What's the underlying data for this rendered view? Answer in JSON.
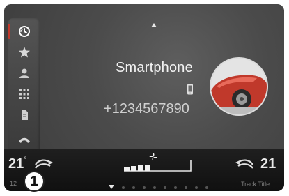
{
  "contact": {
    "name": "Smartphone",
    "number": "+1234567890"
  },
  "climate": {
    "left_temp": "21",
    "left_unit": "°",
    "right_temp": "21",
    "left_sub": "12",
    "right_sub": "Track Title"
  },
  "callout": {
    "label": "1"
  },
  "sidebar": {
    "items": [
      {
        "icon": "recent-calls-icon",
        "active": true
      },
      {
        "icon": "favorites-star-icon"
      },
      {
        "icon": "contacts-icon"
      },
      {
        "icon": "keypad-icon"
      },
      {
        "icon": "messages-icon"
      },
      {
        "icon": "hang-up-icon"
      }
    ]
  },
  "colors": {
    "accent": "#c0392b",
    "screen_bg": "#4b4b4b",
    "bar_bg": "#151515"
  }
}
